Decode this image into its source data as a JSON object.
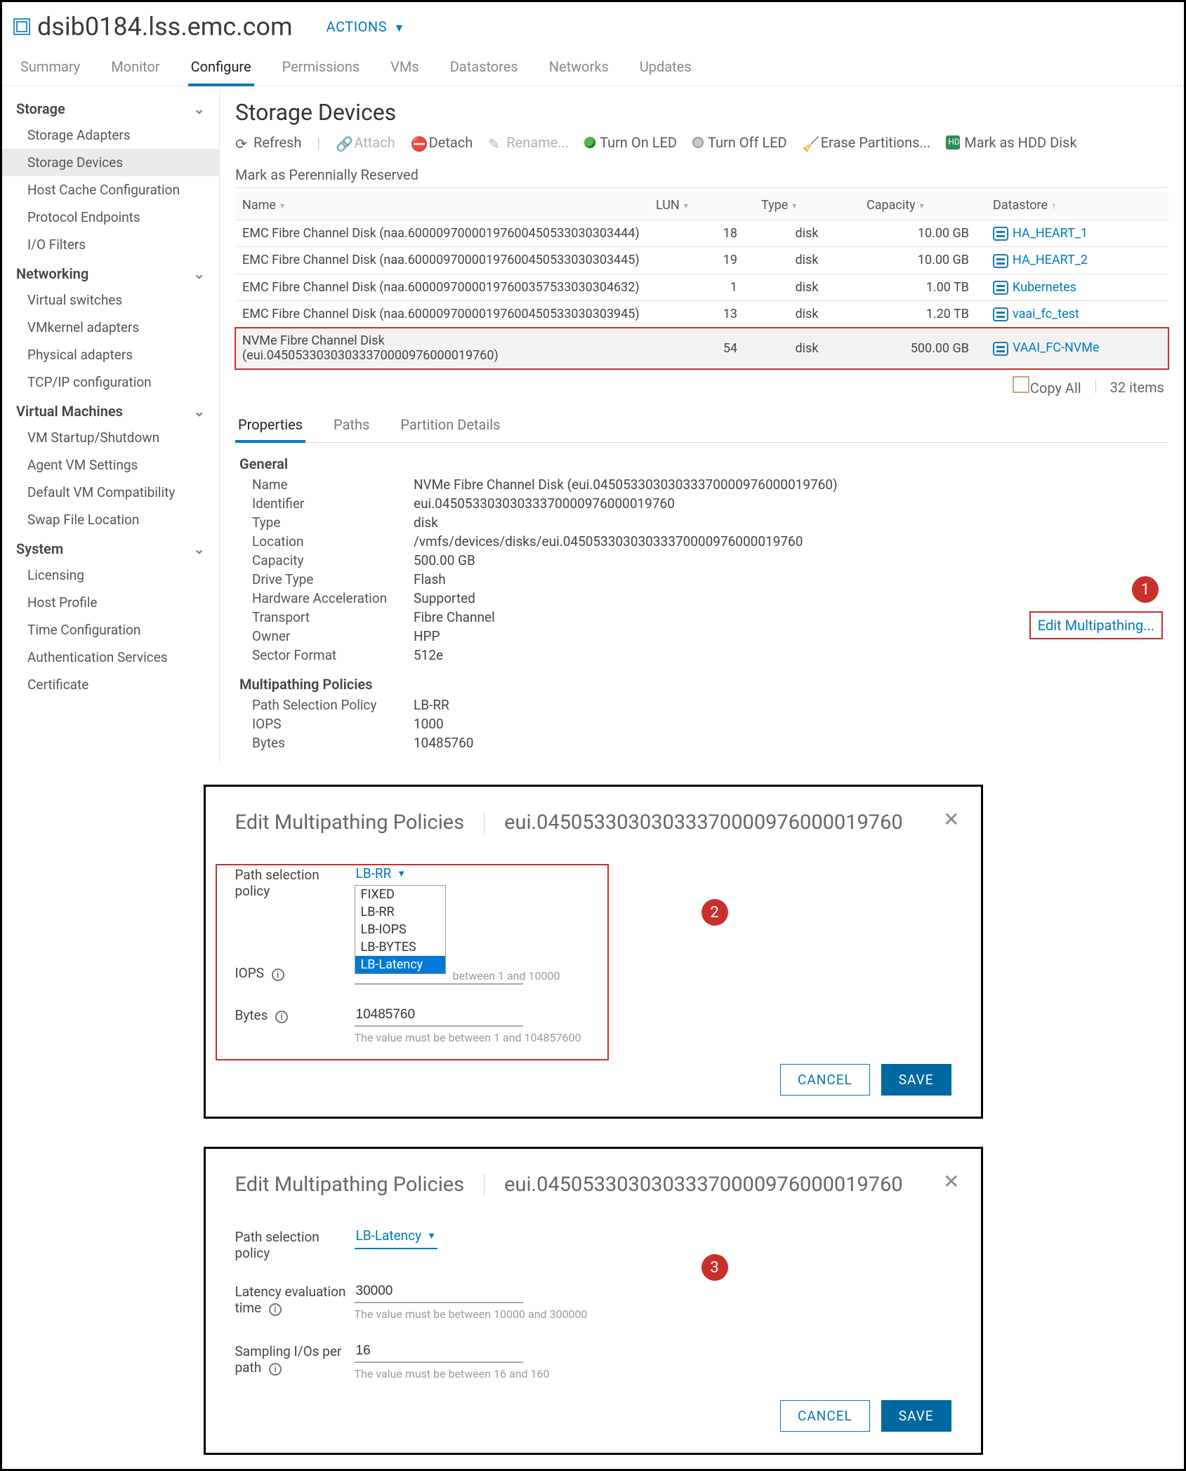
{
  "host_title": "dsib0184.lss.emc.com",
  "actions_label": "ACTIONS",
  "primary_tabs": [
    "Summary",
    "Monitor",
    "Configure",
    "Permissions",
    "VMs",
    "Datastores",
    "Networks",
    "Updates"
  ],
  "primary_tabs_active": 2,
  "sidebar": {
    "groups": [
      {
        "title": "Storage",
        "items": [
          "Storage Adapters",
          "Storage Devices",
          "Host Cache Configuration",
          "Protocol Endpoints",
          "I/O Filters"
        ],
        "active": 1
      },
      {
        "title": "Networking",
        "items": [
          "Virtual switches",
          "VMkernel adapters",
          "Physical adapters",
          "TCP/IP configuration"
        ]
      },
      {
        "title": "Virtual Machines",
        "items": [
          "VM Startup/Shutdown",
          "Agent VM Settings",
          "Default VM Compatibility",
          "Swap File Location"
        ]
      },
      {
        "title": "System",
        "items": [
          "Licensing",
          "Host Profile",
          "Time Configuration",
          "Authentication Services",
          "Certificate"
        ]
      }
    ]
  },
  "page_title": "Storage Devices",
  "toolbar": {
    "refresh": "Refresh",
    "attach": "Attach",
    "detach": "Detach",
    "rename": "Rename...",
    "turn_on_led": "Turn On LED",
    "turn_off_led": "Turn Off LED",
    "erase": "Erase Partitions...",
    "hdd": "Mark as HDD Disk",
    "perennial": "Mark as Perennially Reserved"
  },
  "columns": [
    "Name",
    "LUN",
    "Type",
    "Capacity",
    "Datastore"
  ],
  "sort_arrow_col": 4,
  "devices": [
    {
      "name": "EMC Fibre Channel Disk (naa.60000970000197600450533030303444)",
      "lun": "18",
      "type": "disk",
      "capacity": "10.00 GB",
      "datastore": "HA_HEART_1"
    },
    {
      "name": "EMC Fibre Channel Disk (naa.60000970000197600450533030303445)",
      "lun": "19",
      "type": "disk",
      "capacity": "10.00 GB",
      "datastore": "HA_HEART_2"
    },
    {
      "name": "EMC Fibre Channel Disk (naa.60000970000197600357533030304632)",
      "lun": "1",
      "type": "disk",
      "capacity": "1.00 TB",
      "datastore": "Kubernetes"
    },
    {
      "name": "EMC Fibre Channel Disk (naa.60000970000197600450533030303945)",
      "lun": "13",
      "type": "disk",
      "capacity": "1.20 TB",
      "datastore": "vaai_fc_test"
    },
    {
      "name": "NVMe Fibre Channel Disk (eui.04505330303033370000976000019760)",
      "lun": "54",
      "type": "disk",
      "capacity": "500.00 GB",
      "datastore": "VAAI_FC-NVMe"
    }
  ],
  "selected_row": 4,
  "footer": {
    "copy": "Copy All",
    "count": "32 items"
  },
  "detail_tabs": [
    "Properties",
    "Paths",
    "Partition Details"
  ],
  "detail_tabs_active": 0,
  "props": {
    "general_title": "General",
    "general": [
      [
        "Name",
        "NVMe Fibre Channel Disk (eui.04505330303033370000976000019760)"
      ],
      [
        "Identifier",
        "eui.04505330303033370000976000019760"
      ],
      [
        "Type",
        "disk"
      ],
      [
        "Location",
        "/vmfs/devices/disks/eui.04505330303033370000976000019760"
      ],
      [
        "Capacity",
        "500.00 GB"
      ],
      [
        "Drive Type",
        "Flash"
      ],
      [
        "Hardware Acceleration",
        "Supported"
      ],
      [
        "Transport",
        "Fibre Channel"
      ],
      [
        "Owner",
        "HPP"
      ],
      [
        "Sector Format",
        "512e"
      ]
    ],
    "multipathing_title": "Multipathing Policies",
    "multipathing": [
      [
        "Path Selection Policy",
        "LB-RR"
      ],
      [
        "IOPS",
        "1000"
      ],
      [
        "Bytes",
        "10485760"
      ]
    ],
    "edit_link": "Edit Multipathing..."
  },
  "badges": {
    "one": "1",
    "two": "2",
    "three": "3"
  },
  "dialog2": {
    "title": "Edit Multipathing Policies",
    "subtitle": "eui.04505330303033370000976000019760",
    "policy_label": "Path selection policy",
    "policy_selected": "LB-RR",
    "policy_options": [
      "FIXED",
      "LB-RR",
      "LB-IOPS",
      "LB-BYTES",
      "LB-Latency"
    ],
    "policy_highlight": 4,
    "iops_label": "IOPS",
    "iops_value": "",
    "iops_helper": "between 1 and 10000",
    "bytes_label": "Bytes",
    "bytes_value": "10485760",
    "bytes_helper": "The value must be between 1 and 104857600",
    "cancel": "CANCEL",
    "save": "SAVE"
  },
  "dialog3": {
    "title": "Edit Multipathing Policies",
    "subtitle": "eui.04505330303033370000976000019760",
    "policy_label": "Path selection policy",
    "policy_selected": "LB-Latency",
    "latency_label": "Latency evaluation time",
    "latency_value": "30000",
    "latency_helper": "The value must be between 10000 and 300000",
    "sampling_label": "Sampling I/Os per path",
    "sampling_value": "16",
    "sampling_helper": "The value must be between 16 and 160",
    "cancel": "CANCEL",
    "save": "SAVE"
  }
}
